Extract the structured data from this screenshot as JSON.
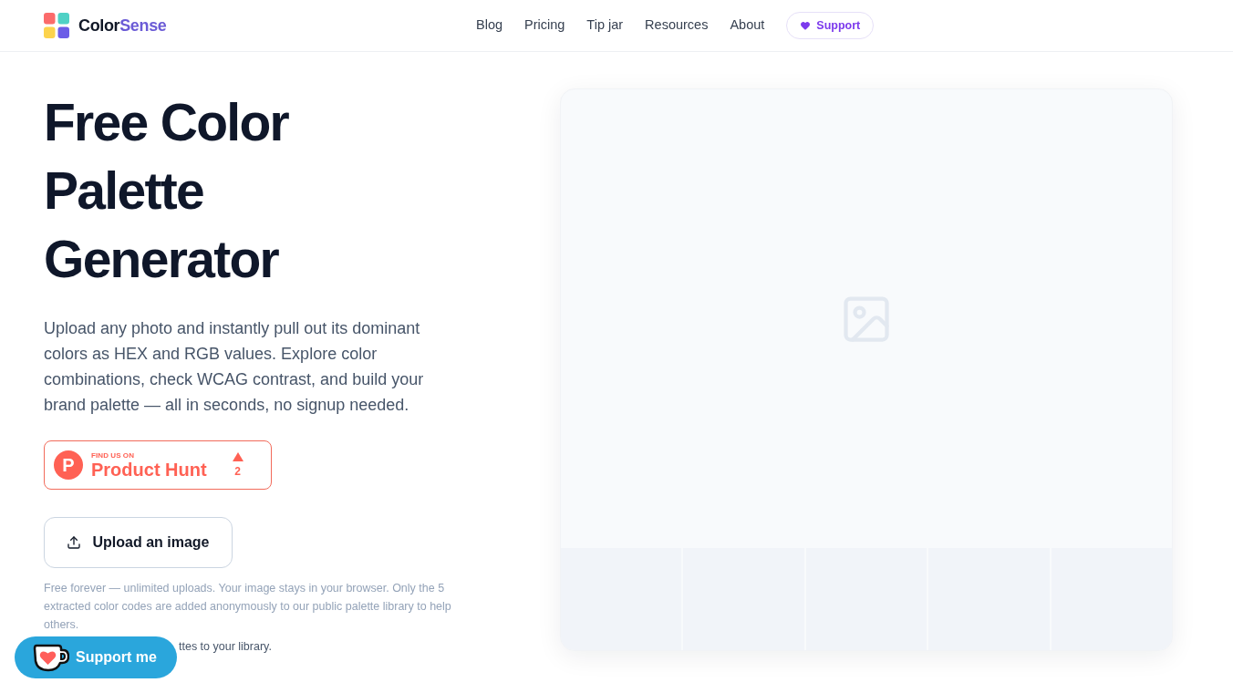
{
  "header": {
    "brand": {
      "name_start": "Color",
      "name_end": "Sense"
    },
    "nav": [
      "Blog",
      "Pricing",
      "Tip jar",
      "Resources",
      "About"
    ],
    "support_button": {
      "label": "Support"
    }
  },
  "hero": {
    "title": "Free Color Palette Generator",
    "description": "Upload any photo and instantly pull out its dominant colors as HEX and RGB values. Explore color combinations, check WCAG contrast, and build your brand palette — all in seconds, no signup needed.",
    "badge": {
      "logo_letter": "P",
      "caption": "FIND US ON",
      "name": "Product Hunt",
      "votes": "2"
    },
    "upload_button": {
      "label": "Upload an image"
    },
    "note": "Free forever — unlimited uploads. Your image stays in your browser. Only the 5 extracted color codes are added anonymously to our public palette library to help others.",
    "note_partial": "ttes to your library."
  },
  "preview": {
    "swatches": [
      {
        "empty": true
      },
      {
        "empty": true
      },
      {
        "empty": true
      },
      {
        "empty": true
      },
      {
        "empty": true
      }
    ]
  },
  "floating_button": {
    "label": "Support me"
  }
}
